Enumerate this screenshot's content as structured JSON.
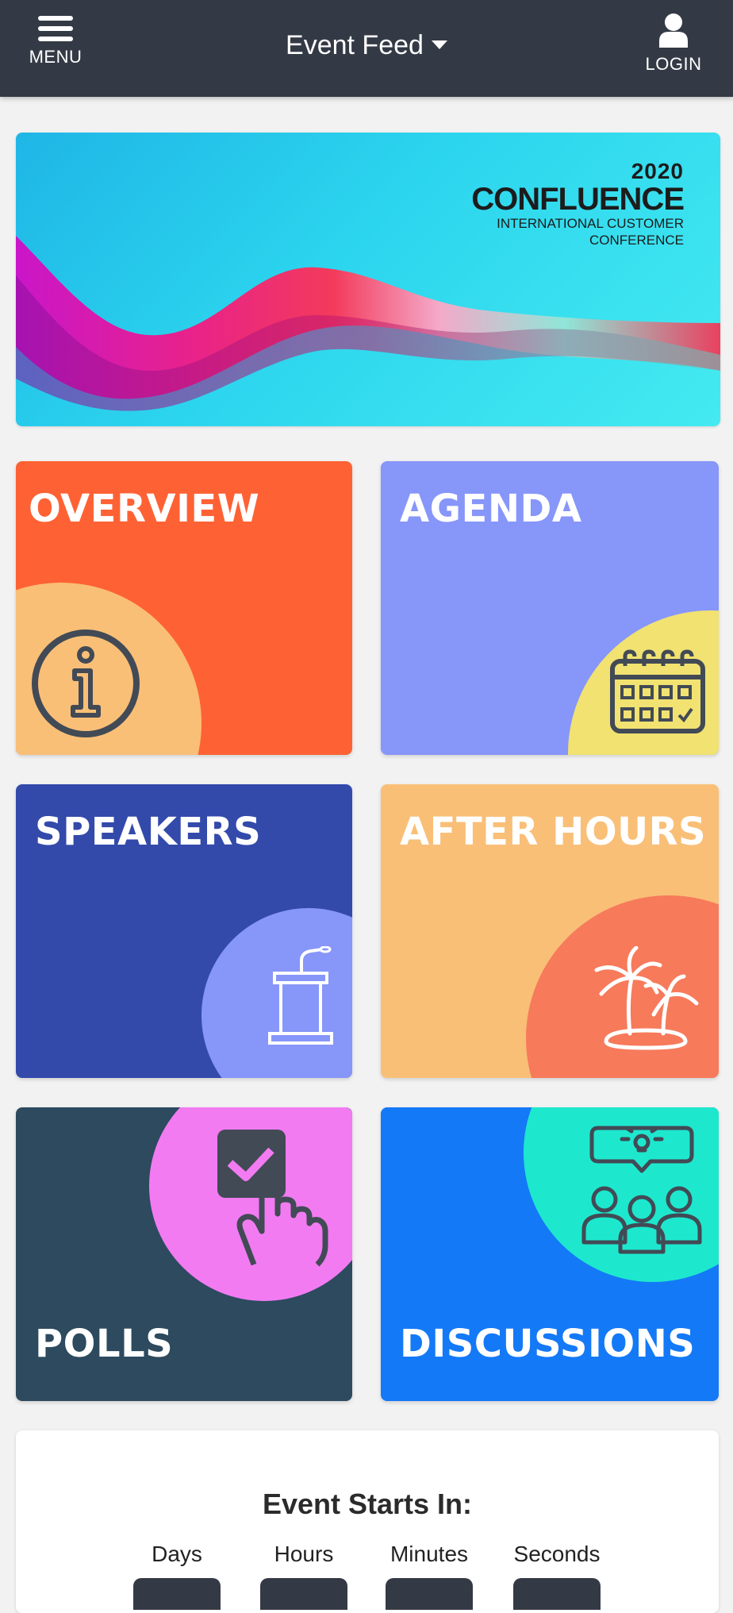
{
  "header": {
    "menu_label": "MENU",
    "title": "Event Feed",
    "login_label": "LOGIN"
  },
  "banner": {
    "year": "2020",
    "brand": "CONFLUENCE",
    "tagline_1": "INTERNATIONAL CUSTOMER",
    "tagline_2": "CONFERENCE"
  },
  "tiles": [
    {
      "label": "OVERVIEW",
      "icon": "info-icon",
      "bg": "#fe6234",
      "accent": "#f9bf77"
    },
    {
      "label": "AGENDA",
      "icon": "calendar-icon",
      "bg": "#8796f9",
      "accent": "#f1e271"
    },
    {
      "label": "SPEAKERS",
      "icon": "podium-icon",
      "bg": "#334aab",
      "accent": "#8796f9"
    },
    {
      "label": "AFTER HOURS",
      "icon": "palm-island-icon",
      "bg": "#f9bf77",
      "accent": "#f77a5b"
    },
    {
      "label": "POLLS",
      "icon": "vote-hand-icon",
      "bg": "#2d4a5e",
      "accent": "#f27bf2"
    },
    {
      "label": "DISCUSSIONS",
      "icon": "group-idea-icon",
      "bg": "#1479f6",
      "accent": "#1de8ce"
    }
  ],
  "countdown": {
    "title": "Event Starts In:",
    "units": [
      "Days",
      "Hours",
      "Minutes",
      "Seconds"
    ]
  }
}
